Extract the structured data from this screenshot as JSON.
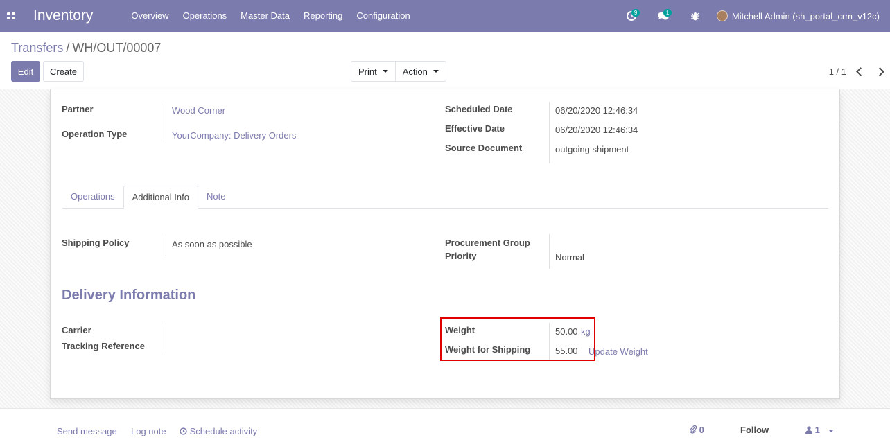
{
  "navbar": {
    "app_title": "Inventory",
    "menu": [
      "Overview",
      "Operations",
      "Master Data",
      "Reporting",
      "Configuration"
    ],
    "activity_count": "9",
    "message_count": "1",
    "user_name": "Mitchell Admin (sh_portal_crm_v12c)"
  },
  "breadcrumb": {
    "parent": "Transfers",
    "separator": "/",
    "current": "WH/OUT/00007"
  },
  "buttons": {
    "edit": "Edit",
    "create": "Create",
    "print": "Print",
    "action": "Action"
  },
  "pager": {
    "value": "1 / 1"
  },
  "form": {
    "partner_label": "Partner",
    "partner_value": "Wood Corner",
    "operation_type_label": "Operation Type",
    "operation_type_value": "YourCompany: Delivery Orders",
    "scheduled_date_label": "Scheduled Date",
    "scheduled_date_value": "06/20/2020 12:46:34",
    "effective_date_label": "Effective Date",
    "effective_date_value": "06/20/2020 12:46:34",
    "source_document_label": "Source Document",
    "source_document_value": "outgoing shipment"
  },
  "tabs": [
    "Operations",
    "Additional Info",
    "Note"
  ],
  "additional_info": {
    "shipping_policy_label": "Shipping Policy",
    "shipping_policy_value": "As soon as possible",
    "procurement_group_label": "Procurement Group",
    "priority_label": "Priority",
    "priority_value": "Normal"
  },
  "delivery": {
    "title": "Delivery Information",
    "carrier_label": "Carrier",
    "tracking_label": "Tracking Reference",
    "weight_label": "Weight",
    "weight_value": "50.00",
    "weight_unit": "kg",
    "shipping_weight_label": "Weight for Shipping",
    "shipping_weight_value": "55.00",
    "update_weight": "Update Weight"
  },
  "chatter": {
    "send_message": "Send message",
    "log_note": "Log note",
    "schedule_activity": "Schedule activity",
    "attachments": "0",
    "follow": "Follow",
    "followers": "1"
  },
  "colors": {
    "brand": "#7c7bad",
    "badge": "#00a09d",
    "highlight": "#e00000"
  }
}
